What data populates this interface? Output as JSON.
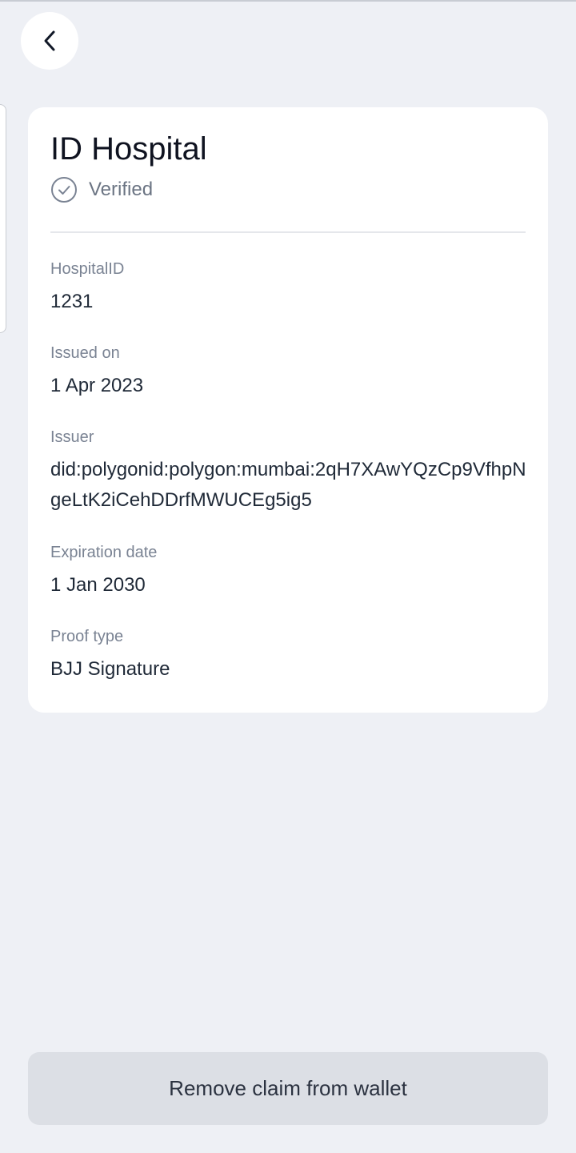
{
  "header": {
    "back_icon": "chevron-left-icon"
  },
  "card": {
    "title": "ID Hospital",
    "status_icon": "check-circle-icon",
    "status": "Verified",
    "fields": [
      {
        "label": "HospitalID",
        "value": "1231"
      },
      {
        "label": "Issued on",
        "value": "1 Apr 2023"
      },
      {
        "label": "Issuer",
        "value": "did:polygonid:polygon:mumbai:2qH7XAwYQzCp9VfhpNgeLtK2iCehDDrfMWUCEg5ig5"
      },
      {
        "label": "Expiration date",
        "value": "1 Jan 2030"
      },
      {
        "label": "Proof type",
        "value": "BJJ Signature"
      }
    ]
  },
  "actions": {
    "remove_label": "Remove claim from wallet"
  },
  "colors": {
    "background": "#eef0f5",
    "card": "#ffffff",
    "button": "#dcdfe5",
    "muted_text": "#7a8393"
  }
}
